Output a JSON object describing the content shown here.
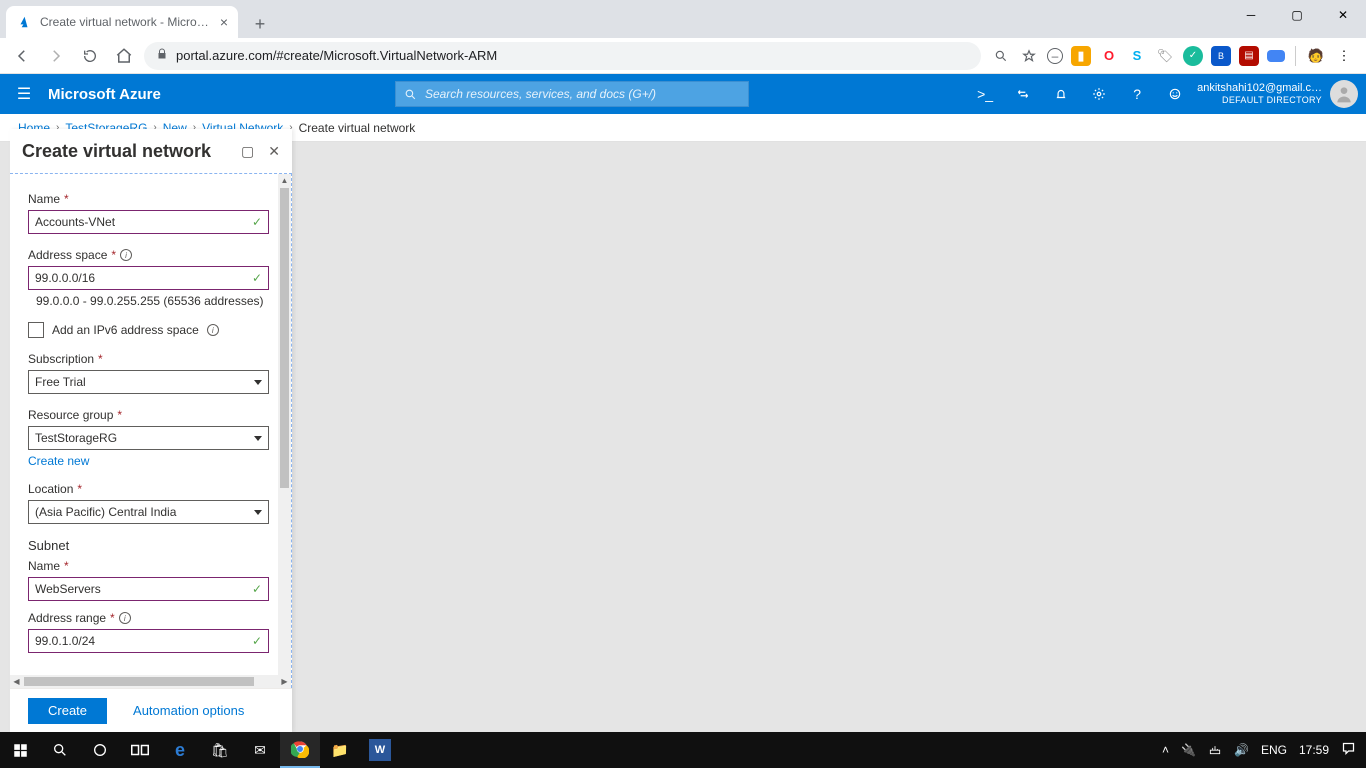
{
  "browser": {
    "tab_title": "Create virtual network - Microsoft",
    "url": "portal.azure.com/#create/Microsoft.VirtualNetwork-ARM"
  },
  "azure_header": {
    "brand": "Microsoft Azure",
    "search_placeholder": "Search resources, services, and docs (G+/)",
    "account_email": "ankitshahi102@gmail.c…",
    "account_directory": "DEFAULT DIRECTORY"
  },
  "breadcrumb": {
    "items": [
      "Home",
      "TestStorageRG",
      "New",
      "Virtual Network"
    ],
    "current": "Create virtual network"
  },
  "blade": {
    "title": "Create virtual network",
    "form": {
      "name_label": "Name",
      "name_value": "Accounts-VNet",
      "address_space_label": "Address space",
      "address_space_value": "99.0.0.0/16",
      "address_space_hint": "99.0.0.0 - 99.0.255.255 (65536 addresses)",
      "ipv6_label": "Add an IPv6 address space",
      "subscription_label": "Subscription",
      "subscription_value": "Free Trial",
      "resource_group_label": "Resource group",
      "resource_group_value": "TestStorageRG",
      "create_new": "Create new",
      "location_label": "Location",
      "location_value": "(Asia Pacific) Central India",
      "subnet_section": "Subnet",
      "subnet_name_label": "Name",
      "subnet_name_value": "WebServers",
      "address_range_label": "Address range",
      "address_range_value": "99.0.1.0/24"
    },
    "footer": {
      "create": "Create",
      "automation": "Automation options"
    }
  },
  "taskbar": {
    "lang": "ENG",
    "time": "17:59"
  }
}
